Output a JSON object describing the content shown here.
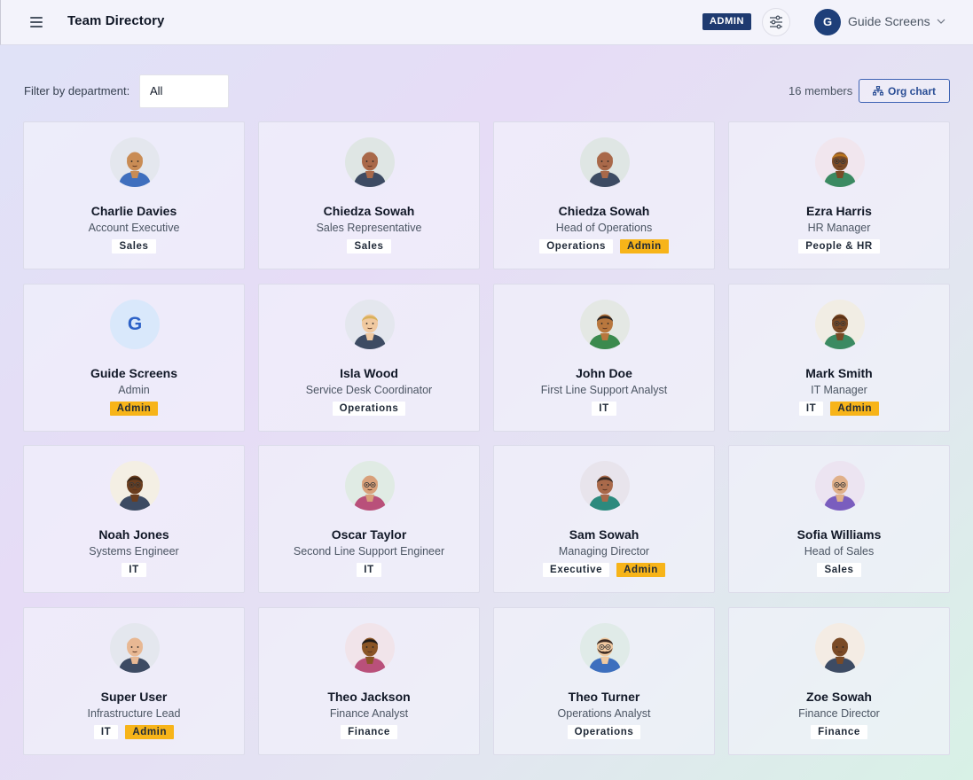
{
  "header": {
    "title": "Team Directory",
    "admin_badge": "ADMIN",
    "user_initial": "G",
    "user_name": "Guide Screens"
  },
  "toolbar": {
    "filter_label": "Filter by department:",
    "filter_value": "All",
    "member_count": "16 members",
    "org_chart_label": "Org chart"
  },
  "colors": {
    "primary": "#1e3a70",
    "admin_tag": "#f7b419",
    "accent_link": "#2c4f96"
  },
  "members": [
    {
      "name": "Charlie Davies",
      "role": "Account Executive",
      "tags": [
        "Sales"
      ],
      "admin": false
    },
    {
      "name": "Chiedza Sowah",
      "role": "Sales Representative",
      "tags": [
        "Sales"
      ],
      "admin": false
    },
    {
      "name": "Chiedza Sowah",
      "role": "Head of Operations",
      "tags": [
        "Operations"
      ],
      "admin": true
    },
    {
      "name": "Ezra Harris",
      "role": "HR Manager",
      "tags": [
        "People & HR"
      ],
      "admin": false
    },
    {
      "name": "Guide Screens",
      "role": "Admin",
      "tags": [],
      "admin": true,
      "initial": "G"
    },
    {
      "name": "Isla Wood",
      "role": "Service Desk Coordinator",
      "tags": [
        "Operations"
      ],
      "admin": false
    },
    {
      "name": "John Doe",
      "role": "First Line Support Analyst",
      "tags": [
        "IT"
      ],
      "admin": false
    },
    {
      "name": "Mark Smith",
      "role": "IT Manager",
      "tags": [
        "IT"
      ],
      "admin": true
    },
    {
      "name": "Noah Jones",
      "role": "Systems Engineer",
      "tags": [
        "IT"
      ],
      "admin": false
    },
    {
      "name": "Oscar Taylor",
      "role": "Second Line Support Engineer",
      "tags": [
        "IT"
      ],
      "admin": false
    },
    {
      "name": "Sam Sowah",
      "role": "Managing Director",
      "tags": [
        "Executive"
      ],
      "admin": true
    },
    {
      "name": "Sofia Williams",
      "role": "Head of Sales",
      "tags": [
        "Sales"
      ],
      "admin": false
    },
    {
      "name": "Super User",
      "role": "Infrastructure Lead",
      "tags": [
        "IT"
      ],
      "admin": true
    },
    {
      "name": "Theo Jackson",
      "role": "Finance Analyst",
      "tags": [
        "Finance"
      ],
      "admin": false
    },
    {
      "name": "Theo Turner",
      "role": "Operations Analyst",
      "tags": [
        "Operations"
      ],
      "admin": false
    },
    {
      "name": "Zoe Sowah",
      "role": "Finance Director",
      "tags": [
        "Finance"
      ],
      "admin": false
    }
  ],
  "admin_tag_label": "Admin"
}
